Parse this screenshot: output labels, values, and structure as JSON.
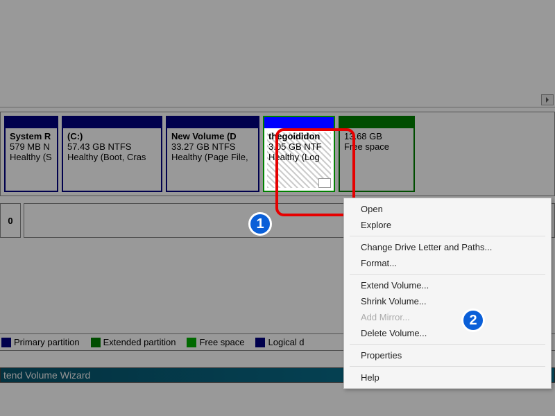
{
  "volumes": {
    "system_reserved": {
      "title": "System R",
      "size": "579 MB N",
      "status": "Healthy (S"
    },
    "c_drive": {
      "title": "  (C:)",
      "size": "57.43 GB NTFS",
      "status": "Healthy (Boot, Cras"
    },
    "new_volume_d": {
      "title": "New Volume  (D",
      "size": "33.27 GB NTFS",
      "status": "Healthy (Page File,"
    },
    "thegoidi": {
      "title": "thegoididon",
      "size": "3.05 GB NTF",
      "status": "Healthy (Log"
    },
    "free_space": {
      "title": "",
      "size": "13.68 GB",
      "status": "Free space"
    }
  },
  "disk_row_label": "0",
  "context_menu": {
    "open": "Open",
    "explore": "Explore",
    "change_letter": "Change Drive Letter and Paths...",
    "format": "Format...",
    "extend": "Extend Volume...",
    "shrink": "Shrink Volume...",
    "add_mirror": "Add Mirror...",
    "delete": "Delete Volume...",
    "properties": "Properties",
    "help": "Help"
  },
  "legend": {
    "primary": "Primary partition",
    "extended": "Extended partition",
    "free": "Free space",
    "logical": "Logical d"
  },
  "wizard": {
    "title": "tend Volume Wizard"
  },
  "callouts": {
    "one": "1",
    "two": "2"
  },
  "colors": {
    "navy": "#000080",
    "green": "#008000",
    "blue": "#0000ff",
    "red": "#e60000",
    "badge": "#0a5fd8"
  }
}
